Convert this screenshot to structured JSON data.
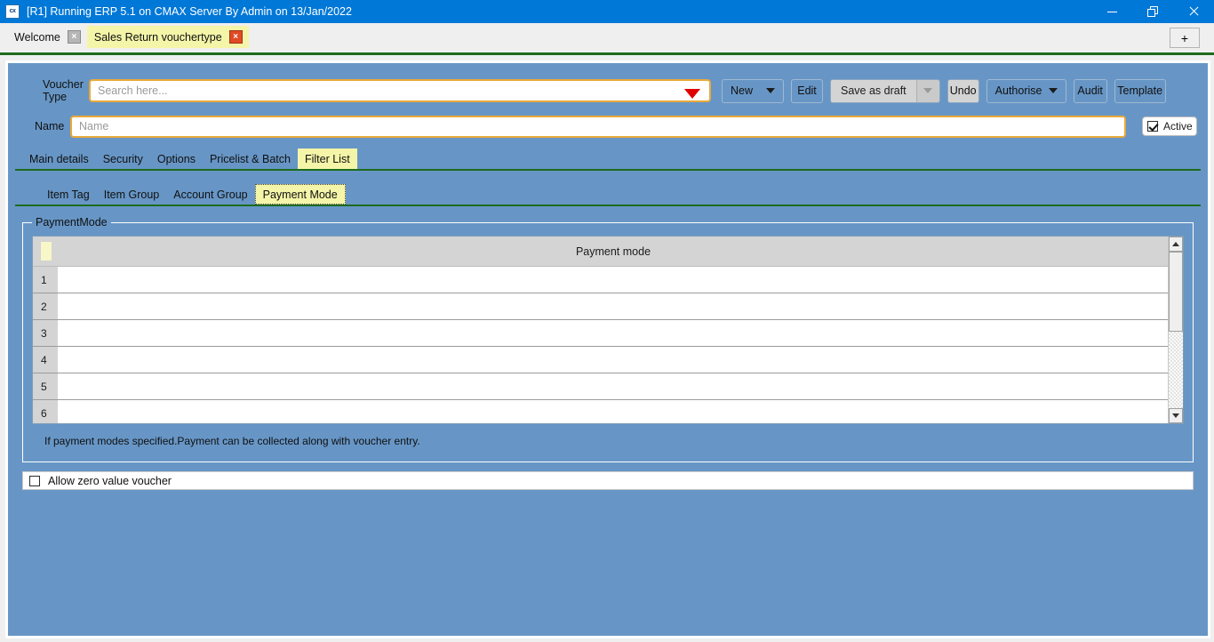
{
  "window": {
    "title": "[R1] Running ERP 5.1 on CMAX Server By Admin on 13/Jan/2022",
    "app_icon": "cx",
    "minimize": "minimize-icon",
    "maximize": "restore-icon",
    "close": "close-icon"
  },
  "doc_tabs": {
    "items": [
      {
        "label": "Welcome",
        "active": false,
        "close": "×"
      },
      {
        "label": "Sales Return vouchertype",
        "active": true,
        "close": "×"
      }
    ],
    "add_label": "+"
  },
  "form": {
    "voucher_type_label": "Voucher Type",
    "voucher_type_placeholder": "Search here...",
    "voucher_type_value": "",
    "name_label": "Name",
    "name_placeholder": "Name",
    "name_value": "",
    "active_label": "Active",
    "active_checked": true
  },
  "toolbar": {
    "new_label": "New",
    "edit_label": "Edit",
    "save_as_draft_label": "Save as draft",
    "undo_label": "Undo",
    "authorise_label": "Authorise",
    "audit_label": "Audit",
    "template_label": "Template"
  },
  "main_tabs": [
    {
      "label": "Main details",
      "active": false
    },
    {
      "label": "Security",
      "active": false
    },
    {
      "label": "Options",
      "active": false
    },
    {
      "label": "Pricelist & Batch",
      "active": false
    },
    {
      "label": "Filter List",
      "active": true
    }
  ],
  "sub_tabs": [
    {
      "label": "Item Tag",
      "active": false
    },
    {
      "label": "Item Group",
      "active": false
    },
    {
      "label": "Account Group",
      "active": false
    },
    {
      "label": "Payment Mode",
      "active": true,
      "focused": true
    }
  ],
  "group": {
    "title": "PaymentMode",
    "grid": {
      "columns": [
        "",
        "Payment mode"
      ],
      "rows": [
        {
          "num": "1",
          "payment_mode": ""
        },
        {
          "num": "2",
          "payment_mode": ""
        },
        {
          "num": "3",
          "payment_mode": ""
        },
        {
          "num": "4",
          "payment_mode": ""
        },
        {
          "num": "5",
          "payment_mode": ""
        },
        {
          "num": "6",
          "payment_mode": ""
        }
      ]
    },
    "hint": "If payment modes specified.Payment can be collected along with voucher entry."
  },
  "footer": {
    "allow_zero_label": "Allow zero value voucher",
    "allow_zero_checked": false
  },
  "colors": {
    "title_bar": "#0078d7",
    "panel_blue": "#6796c6",
    "tab_highlight": "#f4f5a8",
    "green_rule": "#1d6b1d",
    "field_border": "#e9a93a",
    "caret_red": "#e00000"
  }
}
